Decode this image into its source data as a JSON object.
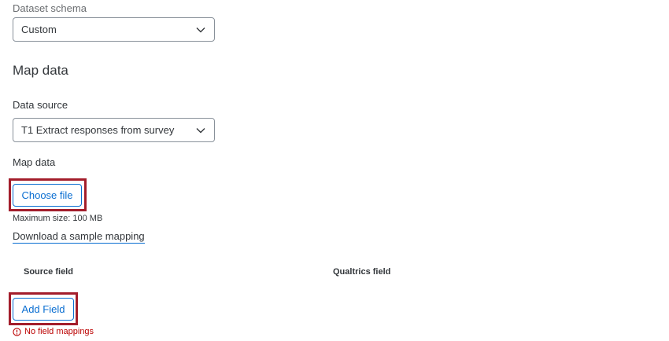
{
  "dataset_schema": {
    "label": "Dataset schema",
    "selected": "Custom",
    "icon": "chevron-down-icon"
  },
  "map_data_section": {
    "title": "Map data"
  },
  "data_source": {
    "label": "Data source",
    "selected": "T1 Extract responses from survey",
    "icon": "chevron-down-icon"
  },
  "map_data_upload": {
    "label": "Map data",
    "choose_file_label": "Choose file",
    "max_size_text": "Maximum size: 100 MB",
    "download_sample_label": "Download a sample mapping"
  },
  "mapping_table": {
    "columns": [
      "Source field",
      "Qualtrics field"
    ],
    "add_field_label": "Add Field",
    "error_text": "No field mappings",
    "error_icon": "error-circle-icon"
  },
  "colors": {
    "accent": "#0a6ed1",
    "highlight": "#a31d2b",
    "error": "#bb0000"
  }
}
